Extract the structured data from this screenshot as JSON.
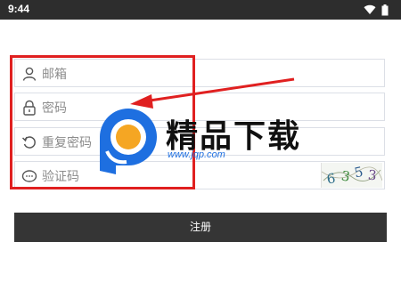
{
  "status_bar": {
    "time": "9:44",
    "wifi_icon": "wifi-icon",
    "battery_icon": "battery-icon"
  },
  "form": {
    "email": {
      "label": "邮箱",
      "icon": "user-icon"
    },
    "password": {
      "label": "密码",
      "icon": "lock-icon"
    },
    "confirm_password": {
      "label": "重复密码",
      "icon": "refresh-icon"
    },
    "captcha": {
      "label": "验证码",
      "icon": "chat-icon",
      "image_text": "6353"
    },
    "submit_label": "注册"
  },
  "watermark": {
    "brand": "精品下载",
    "url": "www.jqp.com"
  },
  "colors": {
    "accent_red": "#e02020",
    "button_bg": "#353535",
    "watermark_blue": "#1e6fe0",
    "watermark_orange": "#f5a623"
  }
}
